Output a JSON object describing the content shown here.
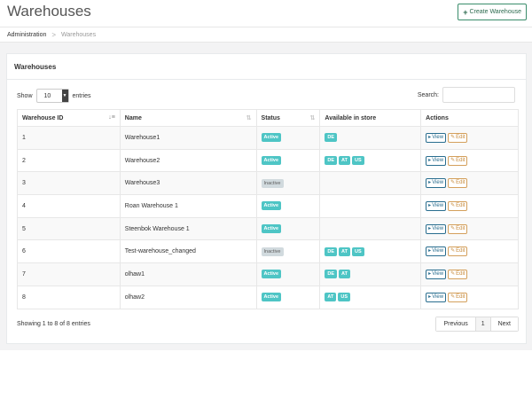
{
  "header": {
    "title": "Warehouses",
    "create_button": "Create Warehouse",
    "create_icon": "+"
  },
  "breadcrumb": {
    "items": [
      "Administration",
      "Warehouses"
    ],
    "separator": ">"
  },
  "panel": {
    "title": "Warehouses"
  },
  "length": {
    "label_before": "Show",
    "value": "10",
    "label_after": "entries"
  },
  "search": {
    "label": "Search:",
    "value": ""
  },
  "table": {
    "columns": [
      "Warehouse ID",
      "Name",
      "Status",
      "Available in store",
      "Actions"
    ],
    "rows": [
      {
        "id": "1",
        "name": "Warehouse1",
        "status": "Active",
        "stores": [
          "DE"
        ]
      },
      {
        "id": "2",
        "name": "Warehouse2",
        "status": "Active",
        "stores": [
          "DE",
          "AT",
          "US"
        ]
      },
      {
        "id": "3",
        "name": "Warehouse3",
        "status": "Inactive",
        "stores": []
      },
      {
        "id": "4",
        "name": "Roan Warehouse 1",
        "status": "Active",
        "stores": []
      },
      {
        "id": "5",
        "name": "Steenbok Warehouse 1",
        "status": "Active",
        "stores": []
      },
      {
        "id": "6",
        "name": "Test-warehouse_changed",
        "status": "Inactive",
        "stores": [
          "DE",
          "AT",
          "US"
        ]
      },
      {
        "id": "7",
        "name": "olhaw1",
        "status": "Active",
        "stores": [
          "DE",
          "AT"
        ]
      },
      {
        "id": "8",
        "name": "olhaw2",
        "status": "Active",
        "stores": [
          "AT",
          "US"
        ]
      }
    ],
    "view_label": "View",
    "edit_label": "Edit"
  },
  "footer": {
    "info": "Showing 1 to 8 of 8 entries",
    "previous": "Previous",
    "page": "1",
    "next": "Next"
  },
  "colors": {
    "active_badge": "#4ec5c5",
    "inactive_badge": "#d1dade",
    "view_btn": "#2a6e8f",
    "edit_btn": "#c78a3a",
    "create_btn_border": "#3a8d6b"
  }
}
